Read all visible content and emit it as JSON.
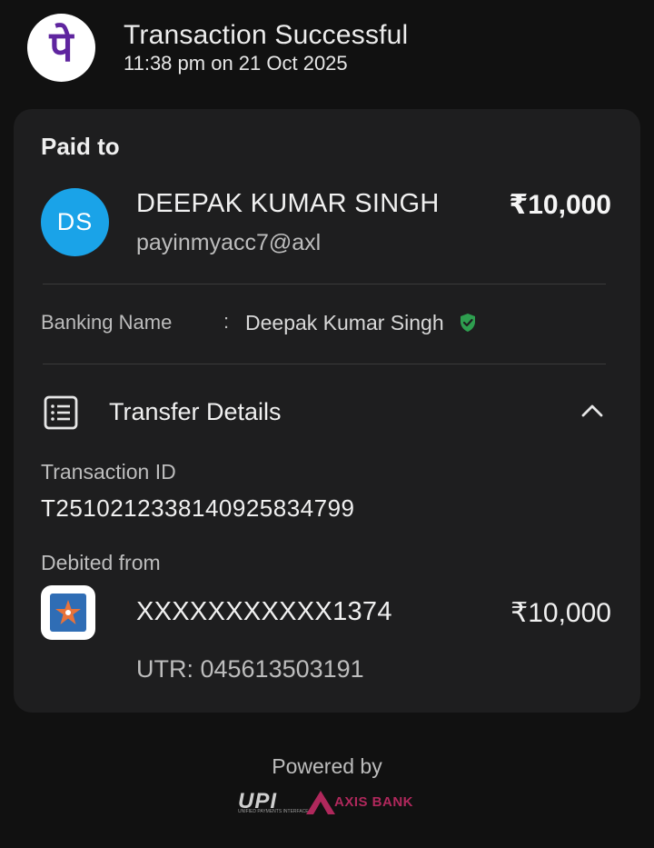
{
  "header": {
    "logo_glyph": "पे",
    "title": "Transaction Successful",
    "subtitle": "11:38 pm on 21 Oct 2025"
  },
  "paid_to": {
    "label": "Paid to",
    "avatar_initials": "DS",
    "name": "DEEPAK KUMAR SINGH",
    "upi_id": "payinmyacc7@axl",
    "amount": "₹10,000"
  },
  "banking": {
    "label": "Banking Name",
    "separator": ":",
    "value": "Deepak Kumar Singh",
    "verified_icon": "shield-check-icon"
  },
  "transfer_details": {
    "title": "Transfer Details",
    "icon": "receipt-list-icon",
    "toggle_icon": "chevron-up-icon",
    "transaction_id_label": "Transaction ID",
    "transaction_id": "T2510212338140925834799",
    "debited_label": "Debited from",
    "account": "XXXXXXXXXXX1374",
    "account_amount": "₹10,000",
    "utr": "UTR: 045613503191"
  },
  "footer": {
    "powered_by": "Powered by",
    "upi_text": "UPI",
    "upi_subtext": "UNIFIED PAYMENTS INTERFACE",
    "bank_text": "AXIS BANK"
  },
  "colors": {
    "background": "#111111",
    "card": "#1e1e1f",
    "brand_purple": "#5f259f",
    "avatar_blue": "#1aa3e8",
    "verified_green": "#2e9e4f",
    "axis_maroon": "#b0285c"
  }
}
